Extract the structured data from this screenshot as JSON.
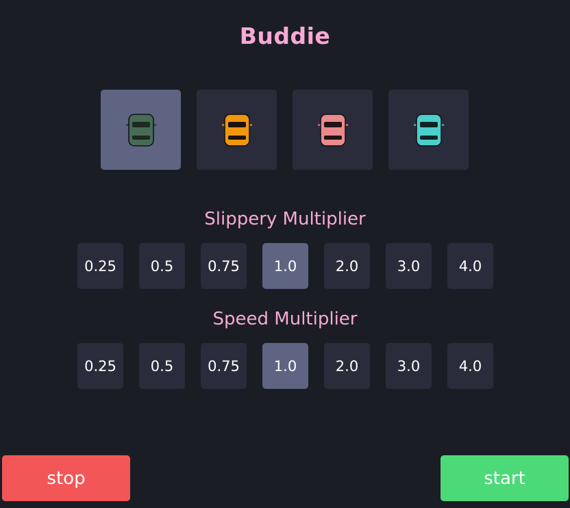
{
  "title": "Buddie",
  "cars": [
    {
      "name": "green",
      "body": "#476b57",
      "accent": "#2d4a3b",
      "window": "#1c2a22",
      "selected": true
    },
    {
      "name": "orange",
      "body": "#f0970f",
      "accent": "#c77406",
      "window": "#1d1309",
      "selected": false
    },
    {
      "name": "pink",
      "body": "#e98a8d",
      "accent": "#c46466",
      "window": "#231314",
      "selected": false
    },
    {
      "name": "teal",
      "body": "#4ccfcb",
      "accent": "#2fa6a3",
      "window": "#0d2424",
      "selected": false
    }
  ],
  "slippery": {
    "label": "Slippery Multiplier",
    "options": [
      "0.25",
      "0.5",
      "0.75",
      "1.0",
      "2.0",
      "3.0",
      "4.0"
    ],
    "selected": "1.0"
  },
  "speed": {
    "label": "Speed Multiplier",
    "options": [
      "0.25",
      "0.5",
      "0.75",
      "1.0",
      "2.0",
      "3.0",
      "4.0"
    ],
    "selected": "1.0"
  },
  "buttons": {
    "stop": "stop",
    "start": "start"
  },
  "colors": {
    "background": "#1b1d25",
    "accent_text": "#f7a9d6",
    "tile": "#2a2c3b",
    "tile_selected": "#5e6482",
    "stop": "#f35657",
    "start": "#4cd978"
  }
}
